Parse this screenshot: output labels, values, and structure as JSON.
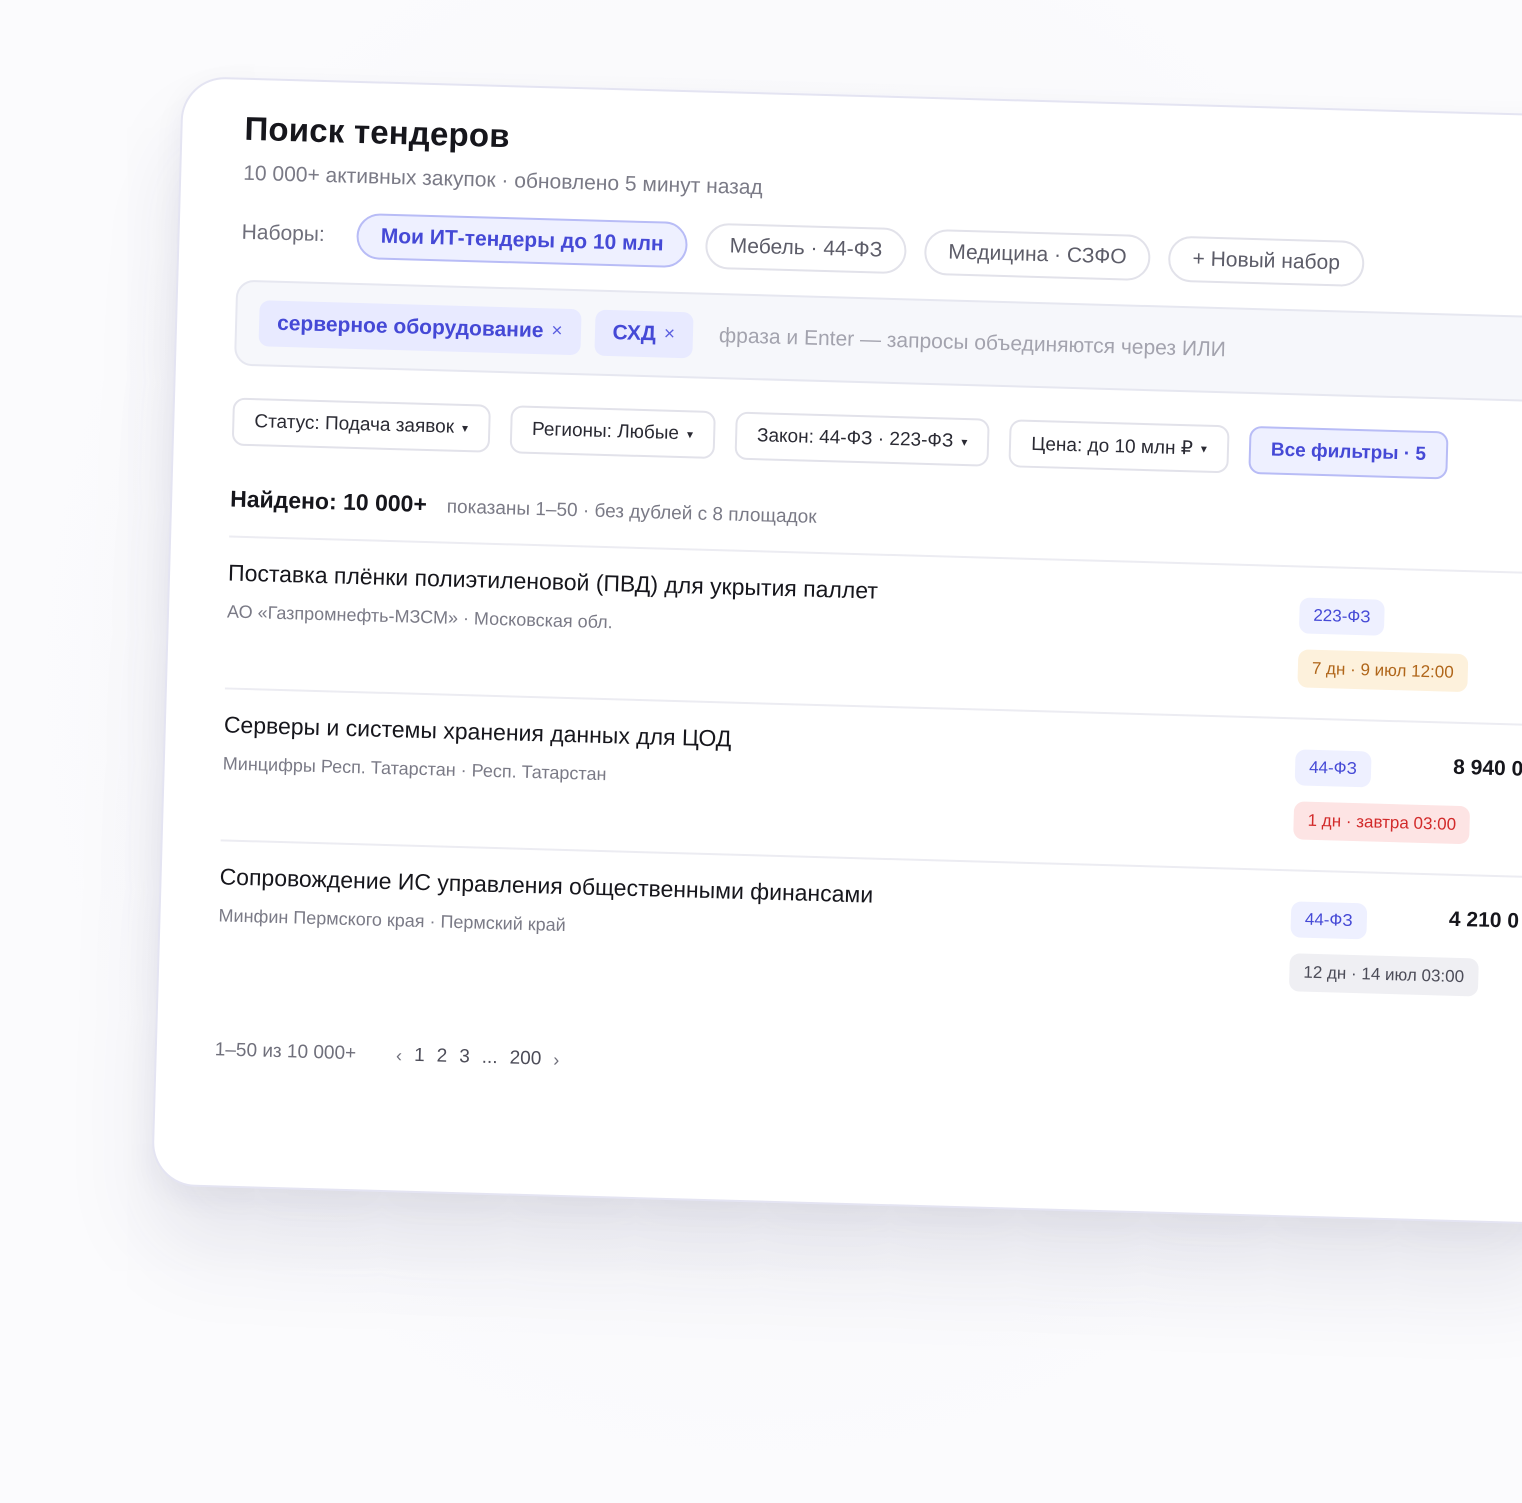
{
  "header": {
    "title": "Поиск тендеров",
    "subtitle": "10 000+ активных закупок · обновлено 5 минут назад"
  },
  "presets": {
    "label": "Наборы:",
    "items": [
      {
        "label": "Мои ИТ-тендеры до 10 млн",
        "active": true
      },
      {
        "label": "Мебель · 44-ФЗ",
        "active": false
      },
      {
        "label": "Медицина · СЗФО",
        "active": false
      }
    ],
    "new_label": "+ Новый набор"
  },
  "search": {
    "chips": [
      {
        "label": "серверное оборудование"
      },
      {
        "label": "СХД"
      }
    ],
    "remove_glyph": "×",
    "placeholder": "фраза и Enter — запросы объединяются через ИЛИ",
    "value": ""
  },
  "filters": {
    "status": "Статус: Подача заявок",
    "regions": "Регионы: Любые",
    "law": "Закон: 44-ФЗ · 223-ФЗ",
    "price": "Цена: до 10 млн ₽",
    "all": "Все фильтры · 5",
    "caret": "▾"
  },
  "results": {
    "found": "Найдено: 10 000+",
    "meta": "показаны 1–50 · без дублей с 8 площадок",
    "rows": [
      {
        "title": "Поставка плёнки полиэтиленовой (ПВД) для укрытия паллет",
        "customer": "АО «Газпромнефть-МЗСМ» · Московская обл.",
        "law": "223-ФЗ",
        "deadline": "7 дн · 9 июл 12:00",
        "deadline_state": "warn",
        "price": ""
      },
      {
        "title": "Серверы и системы хранения данных для ЦОД",
        "customer": "Минцифры Респ. Татарстан · Респ. Татарстан",
        "law": "44-ФЗ",
        "deadline": "1 дн · завтра 03:00",
        "deadline_state": "urgent",
        "price": "8 940 0"
      },
      {
        "title": "Сопровождение ИС управления общественными финансами",
        "customer": "Минфин Пермского края · Пермский край",
        "law": "44-ФЗ",
        "deadline": "12 дн · 14 июл 03:00",
        "deadline_state": "normal",
        "price": "4 210 0"
      }
    ]
  },
  "pagination": {
    "range": "1–50 из 10 000+",
    "prev": "‹",
    "pages": [
      "1",
      "2",
      "3"
    ],
    "ellipsis": "...",
    "last": "200",
    "next": "›"
  },
  "colors": {
    "accent": "#4549d6",
    "warn": "#b0661a",
    "urgent": "#d22a2a"
  }
}
